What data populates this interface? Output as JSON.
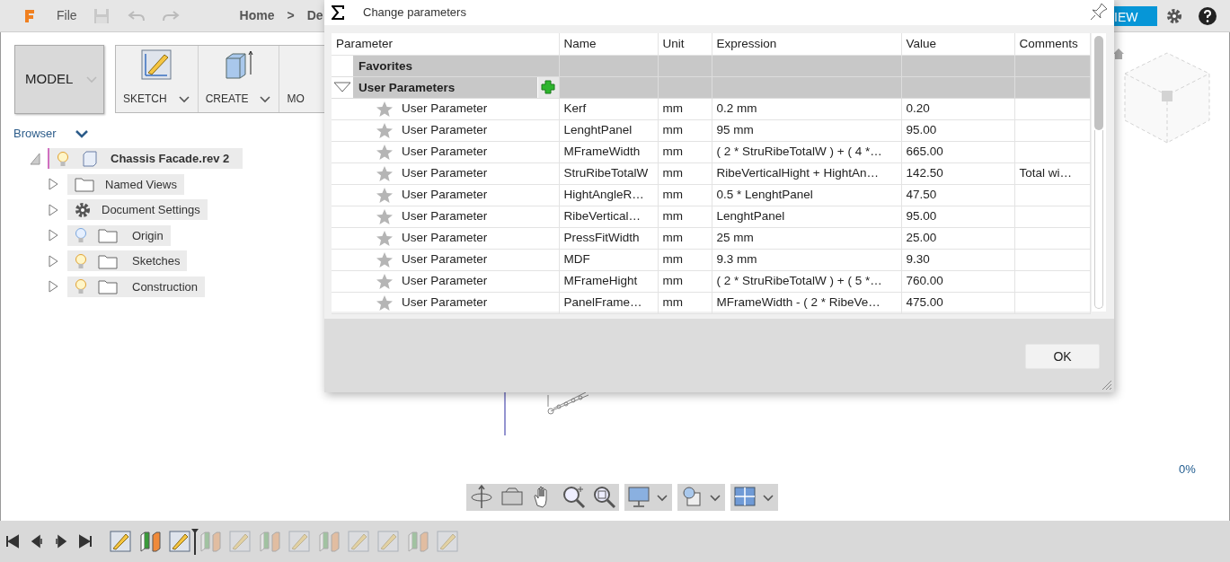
{
  "header": {
    "menu": "File",
    "breadcrumb": [
      "Home",
      ">",
      "De"
    ],
    "view_button": "IEW"
  },
  "workspace": {
    "label": "MODEL"
  },
  "toolbar": [
    {
      "kind": "sketch",
      "label": "SKETCH"
    },
    {
      "kind": "create",
      "label": "CREATE"
    },
    {
      "kind": "cut",
      "label": "MO"
    }
  ],
  "browser": {
    "title": "Browser",
    "root": {
      "label": "Chassis Facade.rev 2",
      "visible": true,
      "expanded": true,
      "children": [
        {
          "kind": "folder",
          "label": "Named Views",
          "expanded": false
        },
        {
          "kind": "settings",
          "label": "Document Settings",
          "expanded": false
        },
        {
          "kind": "folder",
          "label": "Origin",
          "visible": false,
          "expanded": false
        },
        {
          "kind": "folder",
          "label": "Sketches",
          "visible": true,
          "expanded": false
        },
        {
          "kind": "folder",
          "label": "Construction",
          "visible": true,
          "expanded": false
        }
      ]
    }
  },
  "canvas": {
    "progress": "0%"
  },
  "dialog": {
    "title": "Change parameters",
    "columns": [
      "Parameter",
      "Name",
      "Unit",
      "Expression",
      "Value",
      "Comments"
    ],
    "groups": [
      {
        "label": "Favorites",
        "can_add": false
      },
      {
        "label": "User Parameters",
        "expanded": true,
        "can_add": true,
        "rows": [
          {
            "parameter": "User Parameter",
            "favorite": false,
            "name": "Kerf",
            "unit": "mm",
            "expression": "0.2 mm",
            "value": "0.20"
          },
          {
            "parameter": "User Parameter",
            "favorite": false,
            "name": "LenghtPanel",
            "unit": "mm",
            "expression": "95 mm",
            "value": "95.00"
          },
          {
            "parameter": "User Parameter",
            "favorite": false,
            "name": "MFrameWidth",
            "unit": "mm",
            "expression": "( 2 * StruRibeTotalW ) + ( 4 *…",
            "value": "665.00"
          },
          {
            "parameter": "User Parameter",
            "favorite": false,
            "name": "StruRibeTotalW",
            "unit": "mm",
            "expression": "RibeVerticalHight + HightAn…",
            "value": "142.50",
            "comment": "Total wi…"
          },
          {
            "parameter": "User Parameter",
            "favorite": false,
            "name": "HightAngleR…",
            "unit": "mm",
            "expression": "0.5 * LenghtPanel",
            "value": "47.50"
          },
          {
            "parameter": "User Parameter",
            "favorite": false,
            "name": "RibeVertical…",
            "unit": "mm",
            "expression": "LenghtPanel",
            "value": "95.00"
          },
          {
            "parameter": "User Parameter",
            "favorite": false,
            "name": "PressFitWidth",
            "unit": "mm",
            "expression": "25 mm",
            "value": "25.00"
          },
          {
            "parameter": "User Parameter",
            "favorite": false,
            "name": "MDF",
            "unit": "mm",
            "expression": "9.3 mm",
            "value": "9.30"
          },
          {
            "parameter": "User Parameter",
            "favorite": false,
            "name": "MFrameHight",
            "unit": "mm",
            "expression": "( 2 * StruRibeTotalW ) + ( 5 *…",
            "value": "760.00"
          },
          {
            "parameter": "User Parameter",
            "favorite": false,
            "name": "PanelFrame…",
            "unit": "mm",
            "expression": "MFrameWidth - ( 2 * RibeVe…",
            "value": "475.00"
          }
        ]
      }
    ],
    "ok": "OK"
  },
  "timeline": [
    {
      "kind": "sketch",
      "rolled_back": false
    },
    {
      "kind": "extrude",
      "rolled_back": false
    },
    {
      "kind": "sketch",
      "rolled_back": false
    },
    {
      "kind": "extrude",
      "rolled_back": true
    },
    {
      "kind": "sketch",
      "rolled_back": true
    },
    {
      "kind": "extrude",
      "rolled_back": true
    },
    {
      "kind": "sketch",
      "rolled_back": true
    },
    {
      "kind": "extrude",
      "rolled_back": true
    },
    {
      "kind": "sketch",
      "rolled_back": true
    },
    {
      "kind": "sketch",
      "rolled_back": true
    },
    {
      "kind": "extrude",
      "rolled_back": true
    },
    {
      "kind": "sketch",
      "rolled_back": true
    }
  ]
}
